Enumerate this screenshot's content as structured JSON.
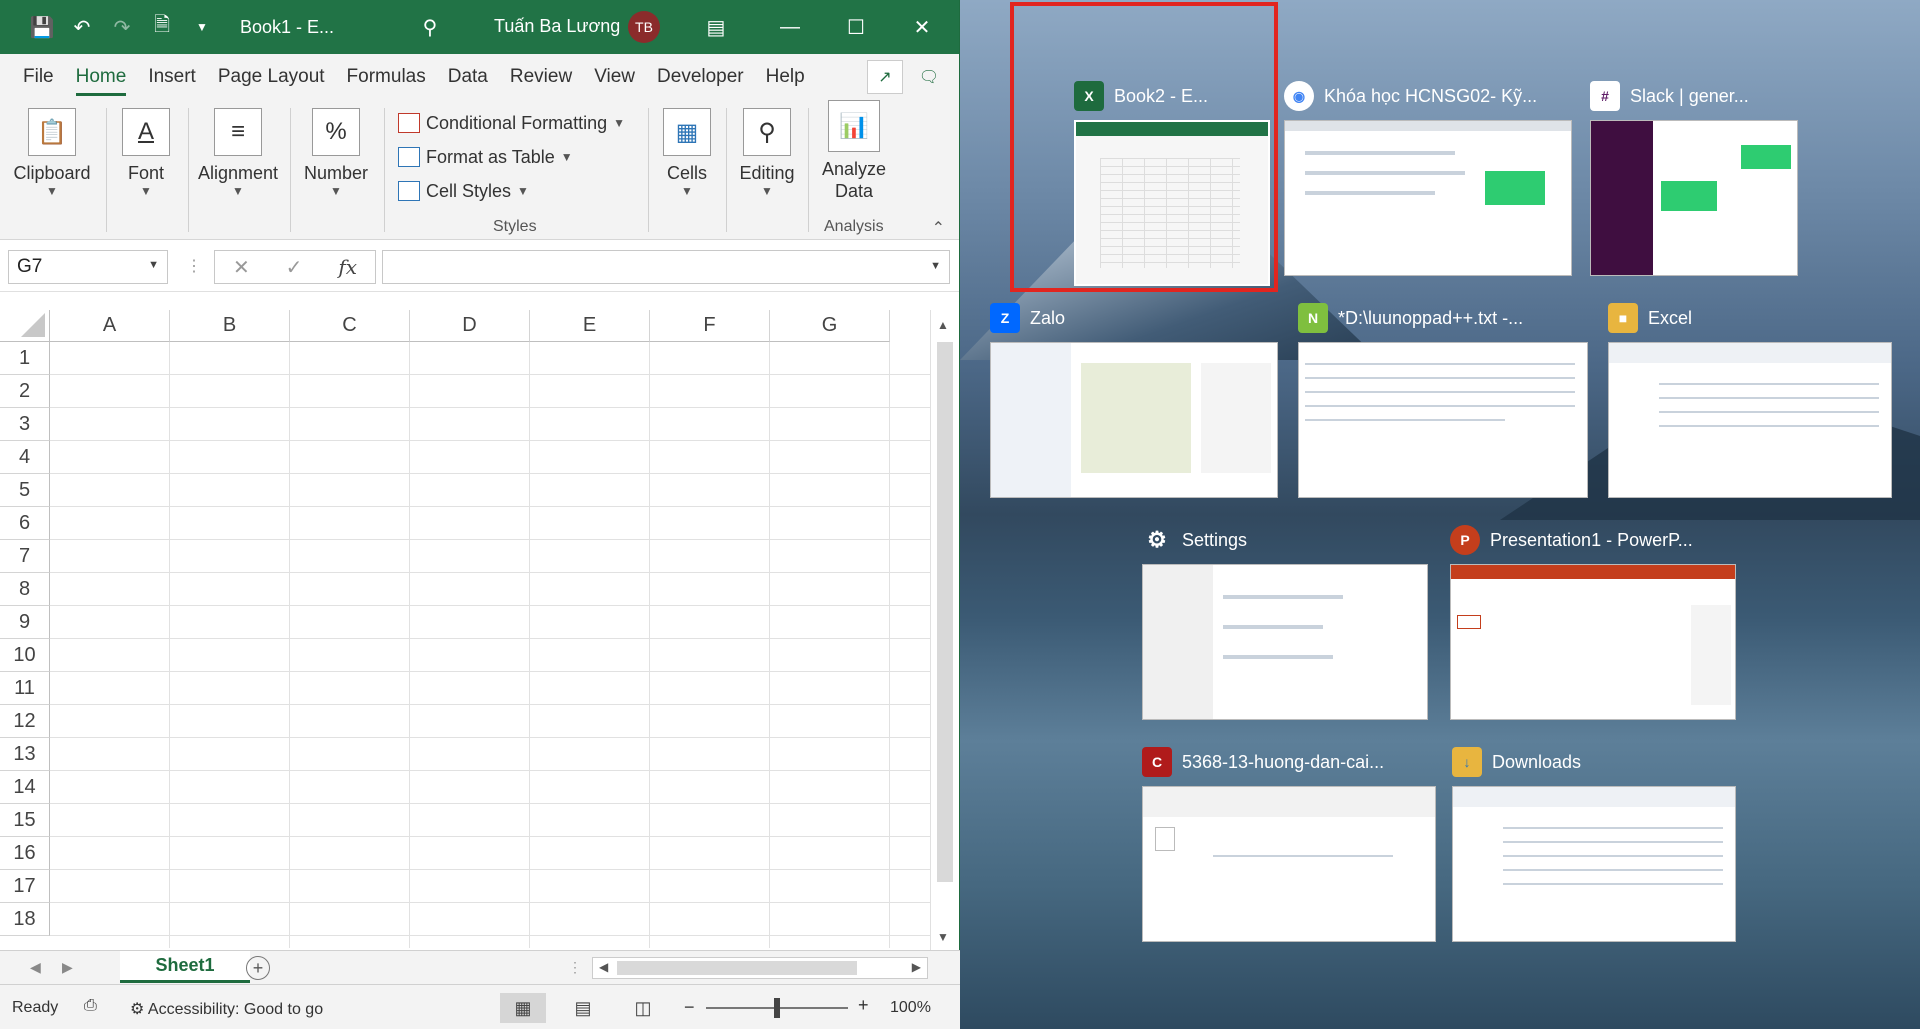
{
  "excel": {
    "doc_title": "Book1  -  E...",
    "user_name": "Tuấn Ba Lương",
    "user_initials": "TB",
    "menu": [
      "File",
      "Home",
      "Insert",
      "Page Layout",
      "Formulas",
      "Data",
      "Review",
      "View",
      "Developer",
      "Help"
    ],
    "active_menu": "Home",
    "ribbon": {
      "clipboard": "Clipboard",
      "font": "Font",
      "alignment": "Alignment",
      "number": "Number",
      "conditional_formatting": "Conditional Formatting",
      "format_as_table": "Format as Table",
      "cell_styles": "Cell Styles",
      "styles_caption": "Styles",
      "cells": "Cells",
      "editing": "Editing",
      "analyze_data_line1": "Analyze",
      "analyze_data_line2": "Data",
      "analysis_caption": "Analysis"
    },
    "name_box": "G7",
    "fx_label": "fx",
    "columns": [
      "A",
      "B",
      "C",
      "D",
      "E",
      "F",
      "G"
    ],
    "rows": [
      "1",
      "2",
      "3",
      "4",
      "5",
      "6",
      "7",
      "8",
      "9",
      "10",
      "11",
      "12",
      "13",
      "14",
      "15",
      "16",
      "17",
      "18"
    ],
    "sheet_tab": "Sheet1",
    "status_ready": "Ready",
    "status_accessibility": "Accessibility: Good to go",
    "zoom": "100%"
  },
  "task_view": [
    {
      "title": "Book2 - E...",
      "icon": "excel-icon",
      "color": "#1e6b3e",
      "selected": true
    },
    {
      "title": "Khóa học HCNSG02- Kỹ...",
      "icon": "chrome-icon",
      "color": "#4285f4"
    },
    {
      "title": "Slack | gener...",
      "icon": "slack-icon",
      "color": "#611f69"
    },
    {
      "title": "Zalo",
      "icon": "zalo-icon",
      "color": "#0068ff"
    },
    {
      "title": "*D:\\luunoppad++.txt -...",
      "icon": "notepadpp-icon",
      "color": "#7fbf3f"
    },
    {
      "title": "Excel",
      "icon": "folder-icon",
      "color": "#e8b53f"
    },
    {
      "title": "Settings",
      "icon": "gear-icon",
      "color": "#ffffff"
    },
    {
      "title": "Presentation1 - PowerP...",
      "icon": "powerpoint-icon",
      "color": "#c43e1c"
    },
    {
      "title": "5368-13-huong-dan-cai...",
      "icon": "reader-icon",
      "color": "#b01b1b"
    },
    {
      "title": "Downloads",
      "icon": "downloads-folder-icon",
      "color": "#e8b53f"
    }
  ]
}
